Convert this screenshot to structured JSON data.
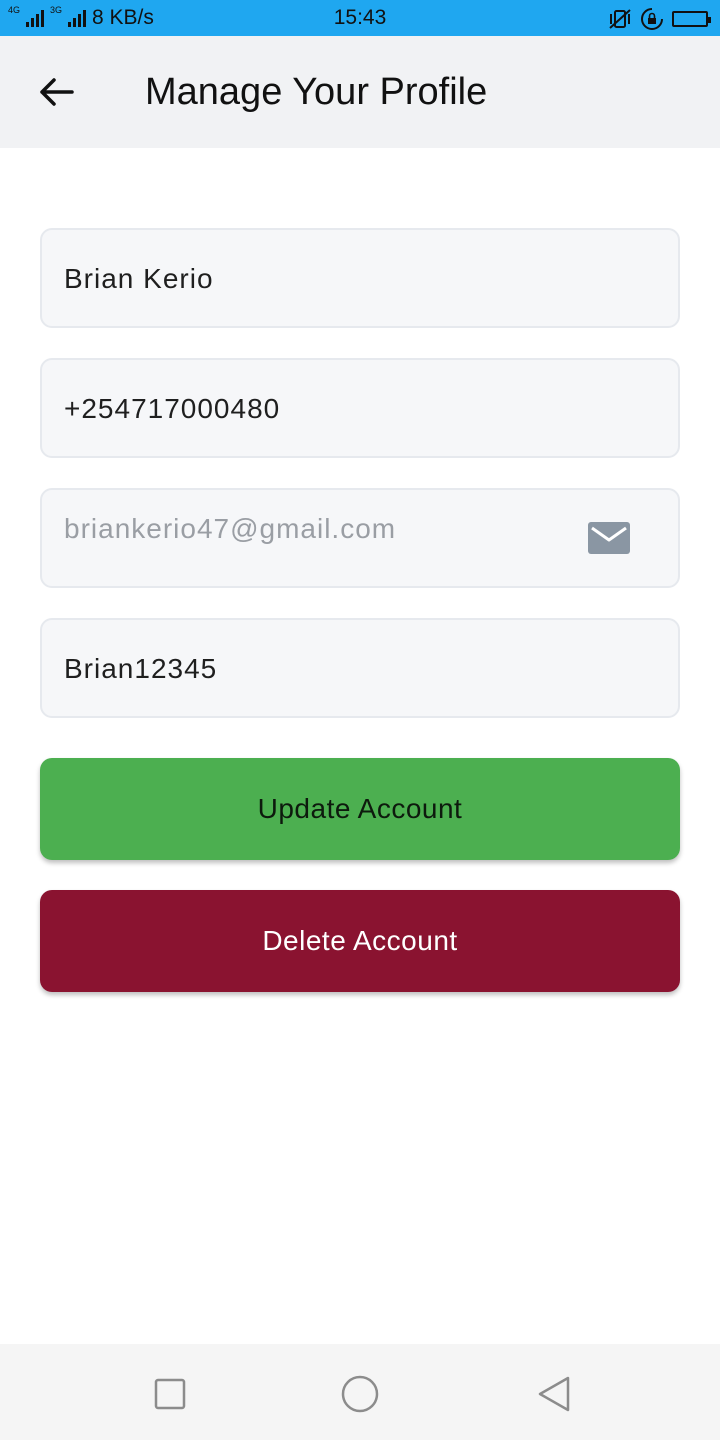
{
  "status_bar": {
    "network_a": "4G",
    "network_b": "3G",
    "speed": "8 KB/s",
    "time": "15:43",
    "icons": [
      "vibrate-off-icon",
      "rotation-lock-icon",
      "battery-icon"
    ]
  },
  "header": {
    "title": "Manage Your Profile",
    "back_icon": "arrow-left-icon"
  },
  "form": {
    "name": "Brian Kerio",
    "phone": "+254717000480",
    "email": "briankerio47@gmail.com",
    "email_icon": "mail-icon",
    "password": "Brian12345"
  },
  "actions": {
    "update_label": "Update Account",
    "delete_label": "Delete Account"
  },
  "colors": {
    "status_bar": "#1fa7f0",
    "app_bar": "#f1f2f4",
    "update_button": "#4caf50",
    "delete_button": "#8a1330"
  },
  "nav": {
    "icons": [
      "recents-square-icon",
      "home-circle-icon",
      "back-triangle-icon"
    ]
  }
}
